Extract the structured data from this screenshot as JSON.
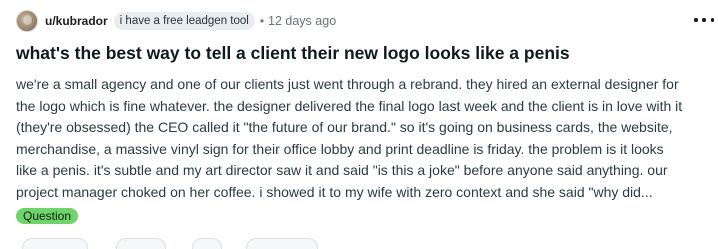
{
  "post": {
    "username": "u/kubrador",
    "flair": "i have a free leadgen tool",
    "separator": "•",
    "time_ago": "12 days ago",
    "title": "what's the best way to tell a client their new logo looks like a penis",
    "body_lines": [
      "we're a small agency and one of our clients just went through a rebrand. they hired an external designer for",
      "the logo which is fine whatever. the designer delivered the final logo last week and the client is in love with it",
      "(they're obsessed) the CEO called it \"the future of our brand.\" so it's going on business cards, the website,",
      "merchandise, a massive vinyl sign for their office lobby and print deadline is friday. the problem is it looks",
      "like a penis. it's subtle and my art director saw it and said \"is this a joke\" before anyone said anything. our",
      "project manager choked on her coffee. i showed it to my wife with zero context and she said \"why did..."
    ],
    "tag": "Question",
    "tag_color": "#6fd46b"
  },
  "icons": {
    "avatar": "user-avatar",
    "more": "overflow-menu-icon"
  }
}
